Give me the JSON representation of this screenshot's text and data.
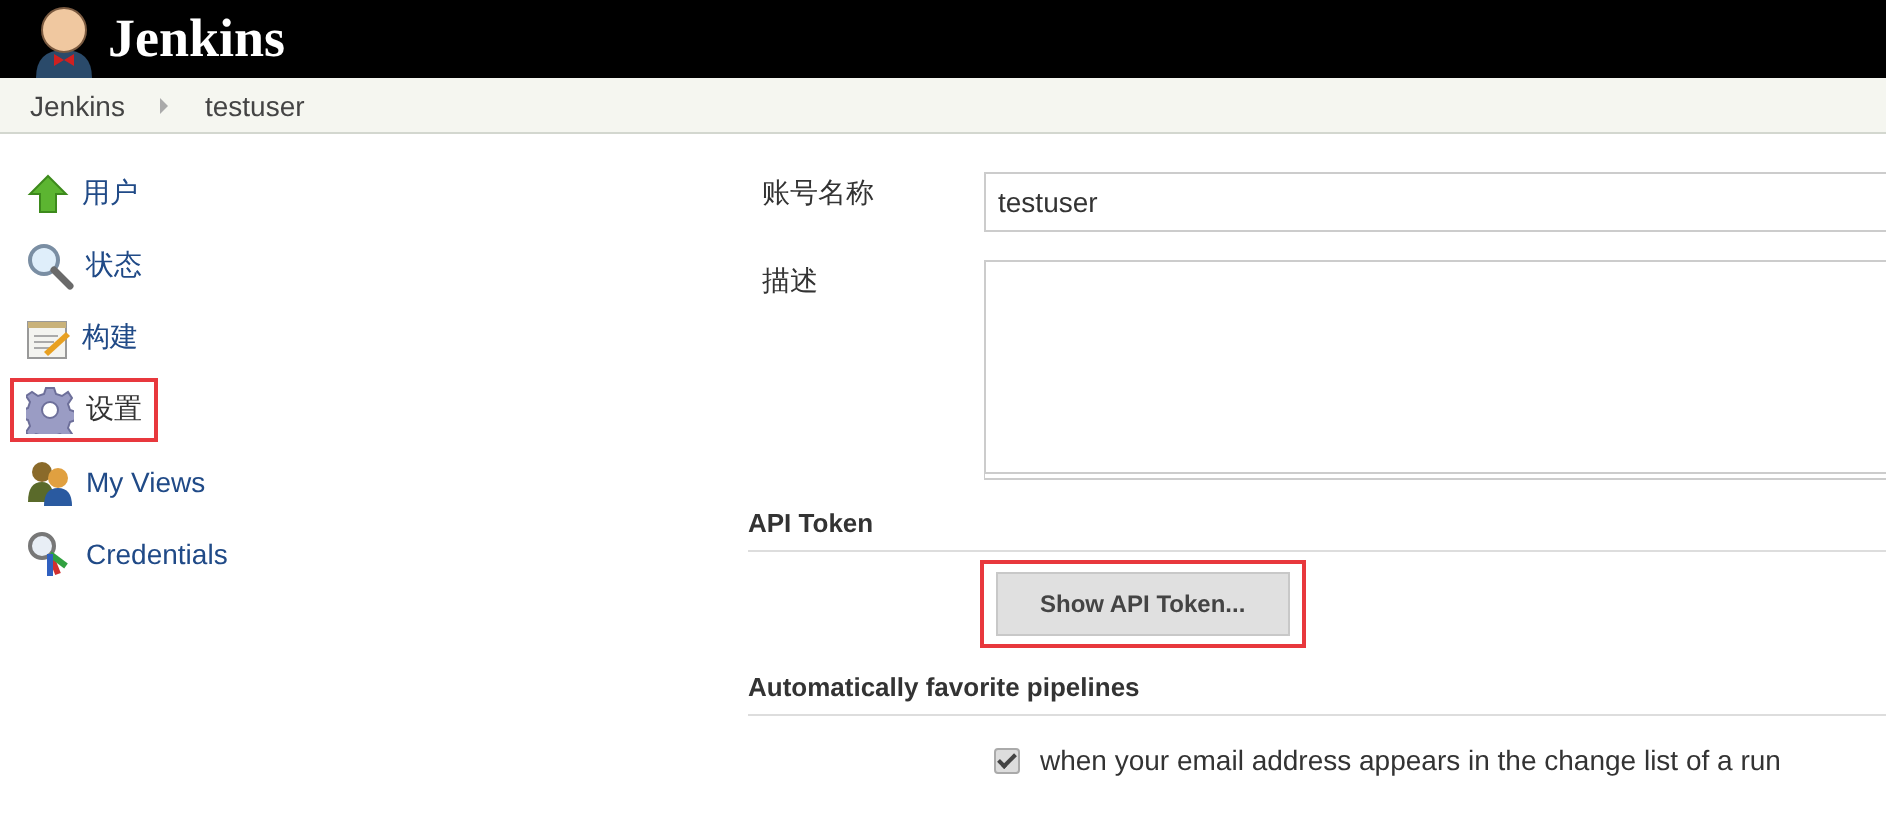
{
  "header": {
    "title": "Jenkins"
  },
  "breadcrumbs": [
    {
      "label": "Jenkins"
    },
    {
      "label": "testuser"
    }
  ],
  "sidebar": {
    "items": [
      {
        "label": "用户",
        "highlighted": false
      },
      {
        "label": "状态",
        "highlighted": false
      },
      {
        "label": "构建",
        "highlighted": false
      },
      {
        "label": "设置",
        "highlighted": true
      },
      {
        "label": "My Views",
        "highlighted": false
      },
      {
        "label": "Credentials",
        "highlighted": false
      }
    ]
  },
  "form": {
    "fields": [
      {
        "label": "账号名称",
        "kind": "text",
        "value": "testuser"
      },
      {
        "label": "描述",
        "kind": "textarea"
      }
    ],
    "sections": [
      {
        "title": "API Token",
        "kind": "button",
        "control": {
          "label": "Show API Token...",
          "highlighted": true
        }
      },
      {
        "title": "Automatically favorite pipelines",
        "kind": "checkbox",
        "control": {
          "label": "when your email address appears in the change list of a run",
          "checked": true
        }
      }
    ]
  }
}
